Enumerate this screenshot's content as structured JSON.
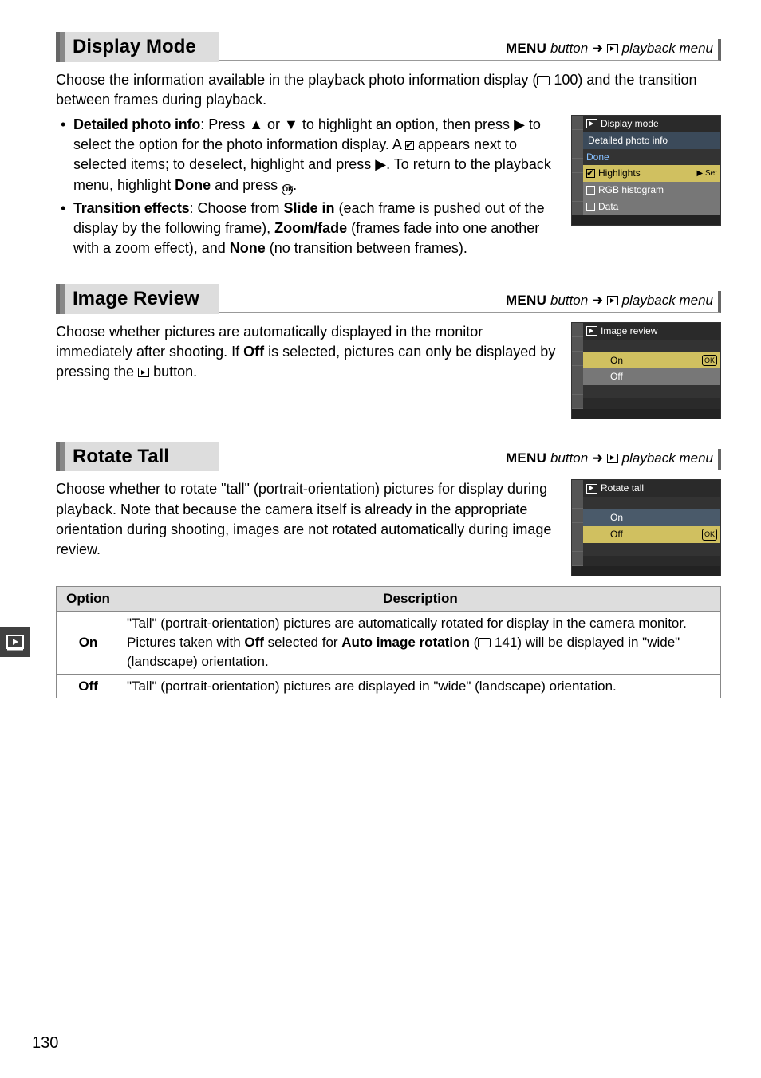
{
  "page_number": "130",
  "breadcrumb_menu": "MENU",
  "breadcrumb_button": " button",
  "breadcrumb_arrow": " ➜ ",
  "breadcrumb_dest": " playback menu",
  "sections": {
    "display_mode": {
      "title": "Display Mode",
      "intro": "Choose the information available in the playback photo information display (",
      "intro_ref": " 100) and the transition between frames during playback.",
      "bullet1_label": "Detailed photo info",
      "bullet1_a": ": Press ",
      "bullet1_b": " or ",
      "bullet1_c": " to highlight an option, then press ",
      "bullet1_d": " to select the option for the photo information display.  A ",
      "bullet1_e": " appears next to selected items; to deselect, highlight and press ",
      "bullet1_f": ".  To return to the playback menu, highlight ",
      "bullet1_done": "Done",
      "bullet1_g": " and press ",
      "bullet1_h": ".",
      "bullet2_label": "Transition effects",
      "bullet2_a": ": Choose from ",
      "bullet2_slide": "Slide in",
      "bullet2_b": " (each frame is pushed out of the display by the following frame), ",
      "bullet2_zoom": "Zoom/fade",
      "bullet2_c": " (frames fade into one another with a zoom effect), and ",
      "bullet2_none": "None",
      "bullet2_d": " (no transition between frames).",
      "sim": {
        "head": "Display mode",
        "sub": "Detailed photo info",
        "done": "Done",
        "hl": "Highlights",
        "set": "▶ Set",
        "rgb": "RGB histogram",
        "data": "Data"
      }
    },
    "image_review": {
      "title": "Image Review",
      "para_a": "Choose whether pictures are automatically displayed in the monitor immediately after shooting.  If ",
      "off": "Off",
      "para_b": " is selected, pictures can only be displayed by pressing the ",
      "para_c": " button.",
      "sim": {
        "head": "Image review",
        "on": "On",
        "off": "Off",
        "ok": "OK"
      }
    },
    "rotate_tall": {
      "title": "Rotate Tall",
      "para": "Choose whether to rotate \"tall\" (portrait-orientation) pictures for display during playback.  Note that because the camera itself is already in the appropriate orientation during shooting, images are not rotated automatically during image review.",
      "sim": {
        "head": "Rotate tall",
        "on": "On",
        "off": "Off",
        "ok": "OK"
      },
      "table": {
        "h_option": "Option",
        "h_desc": "Description",
        "on": "On",
        "on_desc_a": "\"Tall\" (portrait-orientation) pictures are automatically rotated for display in the camera monitor.  Pictures taken with ",
        "on_desc_off": "Off",
        "on_desc_b": " selected for ",
        "on_desc_auto": "Auto image rotation",
        "on_desc_c": " (",
        "on_desc_ref": " 141) will be displayed in \"wide\" (landscape) orientation.",
        "off": "Off",
        "off_desc": "\"Tall\" (portrait-orientation) pictures are displayed in \"wide\" (landscape) orientation."
      }
    }
  }
}
